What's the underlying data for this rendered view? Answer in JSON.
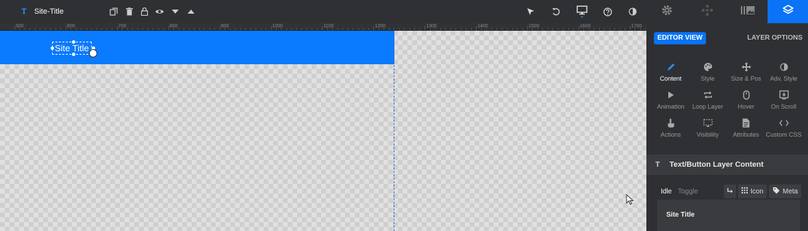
{
  "toolbar": {
    "layer_type": "T",
    "layer_title": "Site-Title",
    "icons": [
      "duplicate-icon",
      "trash-icon",
      "lock-icon",
      "eye-icon",
      "arrow-down-icon",
      "arrow-up-icon",
      "pointer-icon",
      "undo-icon",
      "desktop-icon",
      "help-icon",
      "contrast-icon"
    ]
  },
  "panel_tabs": [
    "gear-icon",
    "navigation-icon",
    "media-icon",
    "layers-icon"
  ],
  "ruler": {
    "labels": [
      "500",
      "600",
      "700",
      "800",
      "900",
      "1000",
      "1100",
      "1200",
      "1300",
      "1400",
      "1500",
      "1600",
      "1700"
    ]
  },
  "canvas": {
    "text_layer": "Site Title",
    "row_color": "#0a7aff"
  },
  "panel": {
    "editor_view": "EDITOR VIEW",
    "layer_options": "LAYER OPTIONS",
    "options": [
      {
        "label": "Content",
        "icon": "pencil-icon"
      },
      {
        "label": "Style",
        "icon": "palette-icon"
      },
      {
        "label": "Size & Pos",
        "icon": "move-icon"
      },
      {
        "label": "Adv. Style",
        "icon": "contrast-icon"
      },
      {
        "label": "Animation",
        "icon": "play-icon"
      },
      {
        "label": "Loop Layer",
        "icon": "loop-icon"
      },
      {
        "label": "Hover",
        "icon": "mouse-icon"
      },
      {
        "label": "On Scroll",
        "icon": "scroll-icon"
      },
      {
        "label": "Actions",
        "icon": "hand-icon"
      },
      {
        "label": "Visibility",
        "icon": "visibility-icon"
      },
      {
        "label": "Attributes",
        "icon": "file-icon"
      },
      {
        "label": "Custom CSS",
        "icon": "code-icon"
      }
    ],
    "section_title": "Text/Button Layer Content",
    "state_idle": "Idle",
    "state_toggle": "Toggle",
    "icon_btn": "Icon",
    "meta_btn": "Meta",
    "content_text": "Site Title"
  },
  "colors": {
    "accent": "#0a73f6",
    "background": "#2f3033"
  }
}
